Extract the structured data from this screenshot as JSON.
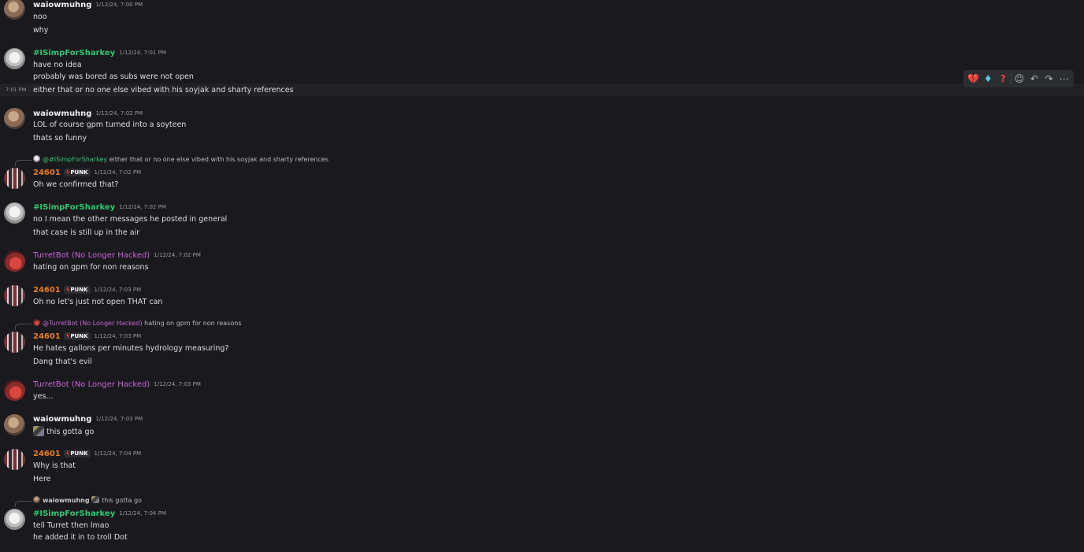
{
  "messages": [
    {
      "author": "waiowmuhng",
      "time": "1/12/24, 7:00 PM",
      "lines": [
        "noo",
        "why"
      ]
    },
    {
      "author": "#ISimpForSharkey",
      "time": "1/12/24, 7:01 PM",
      "lines": [
        "have no idea",
        "probably was bored as subs were not open"
      ]
    },
    {
      "side_time": "7:01 PM",
      "lines": [
        "either that or no one else vibed with his soyjak and sharty references"
      ]
    },
    {
      "author": "waiowmuhng",
      "time": "1/12/24, 7:02 PM",
      "lines": [
        "LOL of course gpm turned into a soyteen",
        "thats so funny"
      ]
    },
    {
      "reply_to": "@#ISimpForSharkey",
      "reply_text": "either that or no one else vibed with his soyjak and sharty references",
      "author": "24601",
      "badge": "PUNK",
      "time": "1/12/24, 7:02 PM",
      "lines": [
        "Oh we confirmed that?"
      ]
    },
    {
      "author": "#ISimpForSharkey",
      "time": "1/12/24, 7:02 PM",
      "lines": [
        "no I mean the other messages he posted in general",
        "that case is still up in the air"
      ]
    },
    {
      "author": "TurretBot (No Longer Hacked)",
      "time": "1/12/24, 7:02 PM",
      "lines": [
        "hating on gpm for non reasons"
      ]
    },
    {
      "author": "24601",
      "badge": "PUNK",
      "time": "1/12/24, 7:03 PM",
      "lines": [
        "Oh no let's just not open THAT can"
      ]
    },
    {
      "reply_to": "@TurretBot (No Longer Hacked)",
      "reply_text": "hating on gpm for non reasons",
      "author": "24601",
      "badge": "PUNK",
      "time": "1/12/24, 7:03 PM",
      "lines": [
        "He hates gallons per minutes hydrology measuring?",
        "Dang that's evil"
      ]
    },
    {
      "author": "TurretBot (No Longer Hacked)",
      "time": "1/12/24, 7:03 PM",
      "lines": [
        "yes..."
      ]
    },
    {
      "author": "waiowmuhng",
      "time": "1/12/24, 7:03 PM",
      "lines": [
        "this gotta go"
      ]
    },
    {
      "author": "24601",
      "badge": "PUNK",
      "time": "1/12/24, 7:04 PM",
      "lines": [
        "Why is that",
        "Here"
      ]
    },
    {
      "reply_to": "waiowmuhng",
      "reply_text": "this gotta go",
      "author": "#ISimpForSharkey",
      "time": "1/12/24, 7:04 PM",
      "lines": [
        "tell Turret then lmao",
        "he added it in to troll Dot"
      ]
    }
  ],
  "toolbar": {
    "reactions": [
      "broken-heart-icon",
      "gem-icon",
      "question-mark-icon"
    ],
    "actions": [
      "add-reaction-icon",
      "reply-icon",
      "forward-icon",
      "more-icon"
    ]
  },
  "colors": {
    "background": "#1a1a1e",
    "simp": "#2dc770",
    "punk": "#e67e22",
    "turret": "#c864d6"
  }
}
